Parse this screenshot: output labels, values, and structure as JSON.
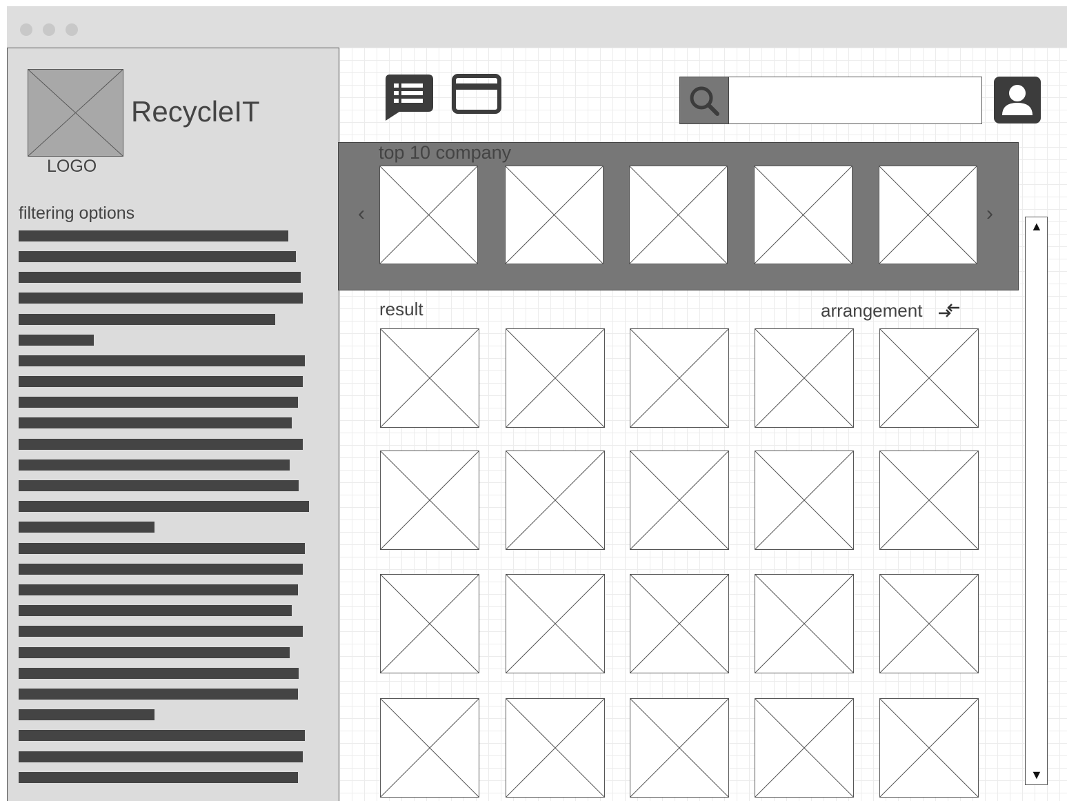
{
  "app": {
    "name": "RecycleIT",
    "logo_label": "LOGO"
  },
  "sidebar": {
    "heading": "filtering options"
  },
  "toolbar": {
    "icons": [
      "list-message-icon",
      "card-icon"
    ],
    "search": {
      "value": "",
      "placeholder": ""
    },
    "profile_icon": "user-icon"
  },
  "carousel": {
    "title": "top 10 company",
    "prev_label": "‹",
    "next_label": "›"
  },
  "results": {
    "label": "result",
    "arrangement_label": "arrangement"
  },
  "scrollbar": {
    "up_label": "▲",
    "down_label": "▼"
  },
  "colors": {
    "sidebar_bg": "#dcdcdc",
    "carousel_bg": "#777777",
    "text": "#444444",
    "placeholder_bg": "#ffffff"
  }
}
